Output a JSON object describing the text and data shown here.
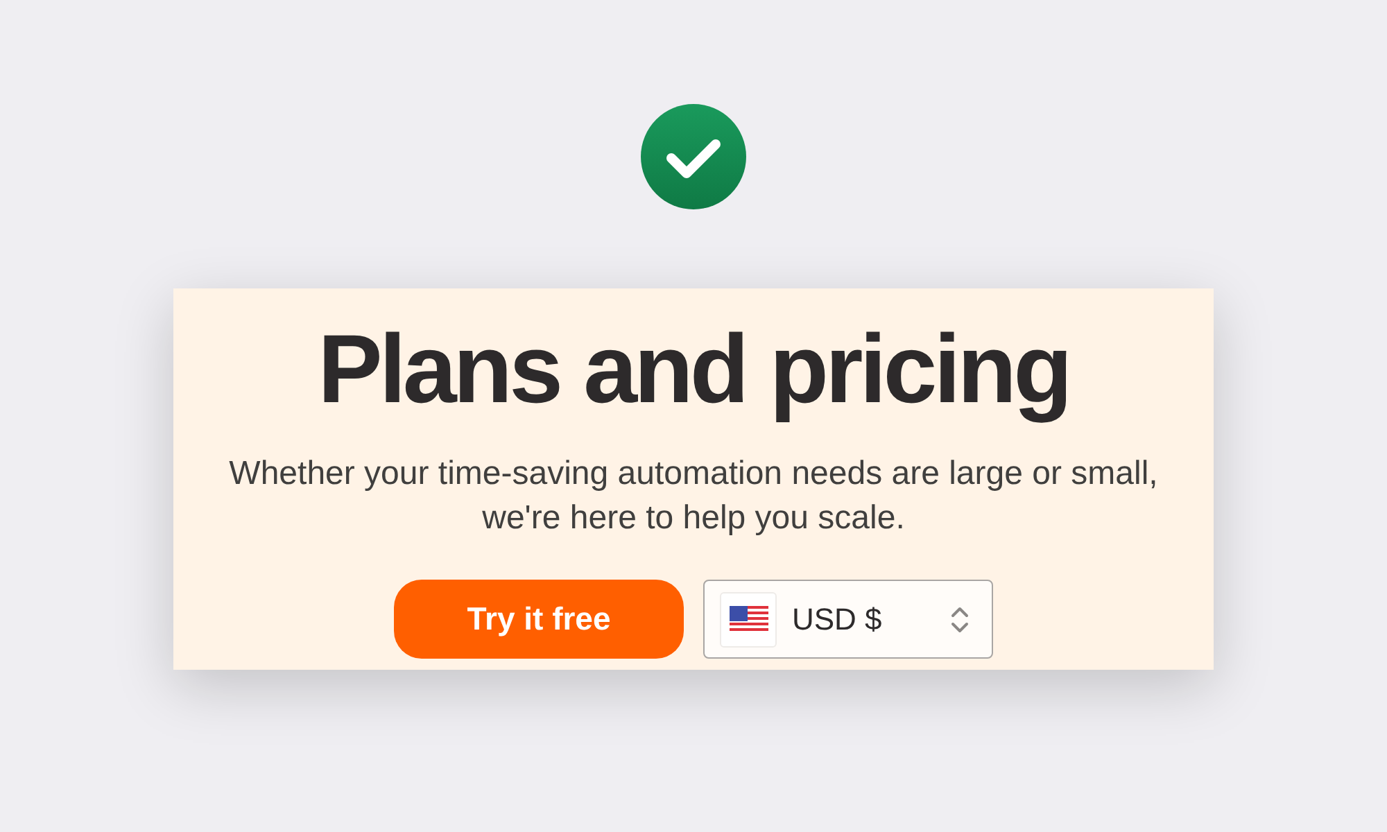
{
  "status": {
    "kind": "success"
  },
  "hero": {
    "title": "Plans and pricing",
    "subtitle": "Whether your time-saving automation needs are large or small, we're here to help you scale.",
    "cta_button": {
      "label": "Try it free"
    },
    "currency_select": {
      "value": "USD $"
    }
  }
}
